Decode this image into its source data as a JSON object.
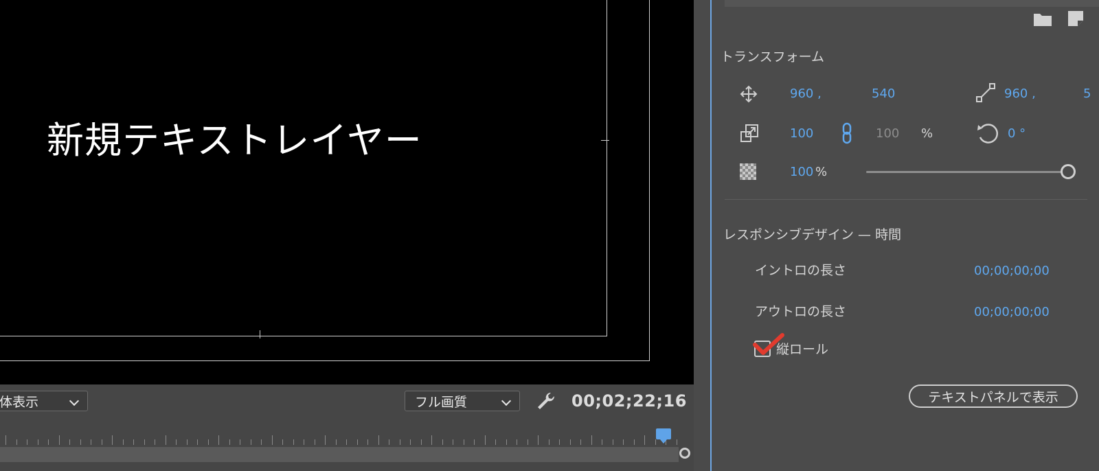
{
  "monitor": {
    "canvas_text": "新規テキストレイヤー",
    "zoom_select": "体表示",
    "quality_select": "フル画質",
    "timecode": "00;02;22;16"
  },
  "icons": {
    "wrench": "wrench-icon",
    "folder": "folder-icon",
    "new_layer": "new-layer-icon",
    "position": "move-arrows-icon",
    "anchor": "anchor-point-icon",
    "scale": "scale-icon",
    "link": "link-icon",
    "rotation": "rotation-icon",
    "opacity": "checker-opacity-icon"
  },
  "transform": {
    "title": "トランスフォーム",
    "position_x": "960 ,",
    "position_y": "540",
    "anchor_x": "960 ,",
    "anchor_y": "5",
    "scale": "100",
    "scale_linked": "100",
    "scale_unit": "%",
    "rotation": "0 °",
    "opacity_value": "100",
    "opacity_unit": "%",
    "opacity_level": 1.0
  },
  "responsive": {
    "title": "レスポンシブデザイン — 時間",
    "intro_label": "イントロの長さ",
    "intro_value": "00;00;00;00",
    "outro_label": "アウトロの長さ",
    "outro_value": "00;00;00;00",
    "roll_label": "縦ロール",
    "roll_checked": true,
    "text_panel_button": "テキストパネルで表示"
  },
  "colors": {
    "accent": "#5fa8ef",
    "annotation": "#e23b2e",
    "panel_bg": "#4b4b4b"
  }
}
